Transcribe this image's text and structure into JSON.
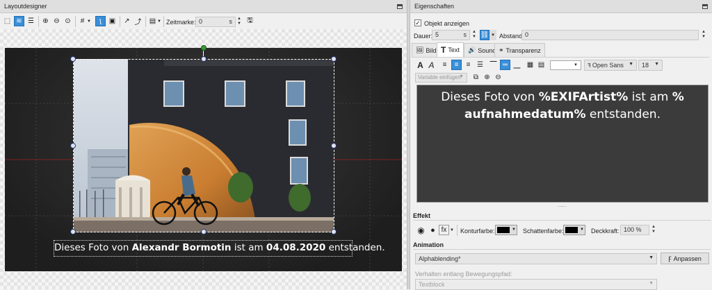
{
  "left_panel": {
    "title": "Layoutdesigner",
    "zeitmarke_label": "Zeitmarke:",
    "zeitmarke_value": "0",
    "zeitmarke_unit": "s",
    "caption_pre": "Dieses Foto von ",
    "caption_artist": "Alexandr Bormotin",
    "caption_mid": " ist am ",
    "caption_date": "04.08.2020",
    "caption_post": " entstanden."
  },
  "right_panel": {
    "title": "Eigenschaften",
    "show_object_label": "Objekt anzeigen",
    "dauer_label": "Dauer:",
    "dauer_value": "5",
    "dauer_unit": "s",
    "abstand_label": "Abstand:",
    "abstand_value": "0",
    "tabs": [
      {
        "label": "Bild",
        "icon": "image-icon"
      },
      {
        "label": "Text",
        "icon": "text-icon"
      },
      {
        "label": "Sound",
        "icon": "sound-icon"
      },
      {
        "label": "Transparenz",
        "icon": "transparency-icon"
      }
    ],
    "font_name": "Open Sans",
    "font_size": "18",
    "variable_placeholder": "Variable einfügen",
    "editor_line1_pre": "Dieses Foto von ",
    "editor_line1_bold1": "%EXIFArtist%",
    "editor_line1_mid": " ist am ",
    "editor_line1_bold2": "%",
    "editor_line2_bold": "aufnahmedatum%",
    "editor_line2_post": " entstanden.",
    "effekt_label": "Effekt",
    "konturfarbe_label": "Konturfarbe:",
    "schattenfarbe_label": "Schattenfarbe:",
    "deckkraft_label": "Deckkraft:",
    "deckkraft_value": "100 %",
    "animation_label": "Animation",
    "animation_value": "Alphablending*",
    "anpassen_label": "Anpassen",
    "path_label": "Verhalten entlang Bewegungspfad:",
    "path_value": "Textblock"
  },
  "colors": {
    "accent": "#3a8fd8",
    "stage": "#2a2a2a",
    "editor_bg": "#3b3b3b"
  }
}
